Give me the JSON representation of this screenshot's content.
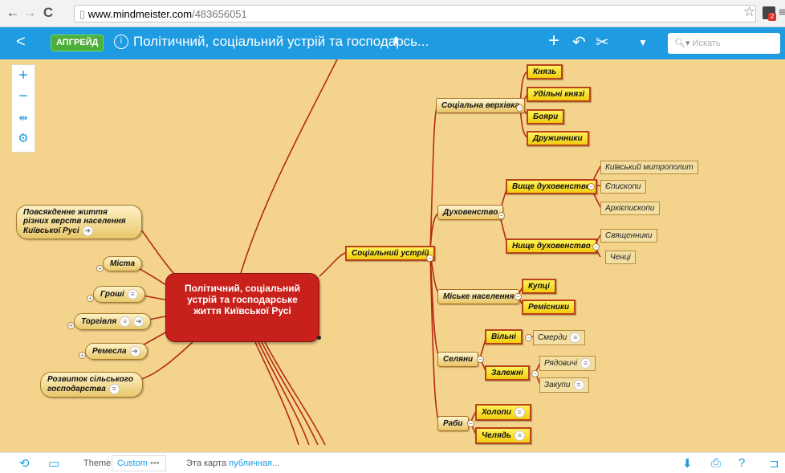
{
  "browser": {
    "url_host": "www.mindmeister.com",
    "url_path": "/483656051",
    "ext_badge": "2"
  },
  "toolbar": {
    "upgrade_label": "АПГРЕЙД",
    "title": "Політичний, соціальний устрій та господарсь...",
    "search_placeholder": "Искать",
    "accent": "#1e9be1"
  },
  "map": {
    "center": "Політичний, соціальний устрій та господарське життя Київської Русі",
    "left_nodes": {
      "daily_life": "Повсякденне життя різних верств населення Київської Русі",
      "cities": "Міста",
      "money": "Гроші",
      "trade": "Торгівля",
      "crafts": "Ремесла",
      "agriculture": "Розвиток сільського господарства"
    },
    "social": {
      "label": "Соціальний устрій",
      "elite": {
        "label": "Соціальна верхівка",
        "items": [
          "Князь",
          "Удільні князі",
          "Бояри",
          "Дружинники"
        ]
      },
      "clergy": {
        "label": "Духовенство",
        "higher": {
          "label": "Вище духовенство",
          "items": [
            "Київський митрополит",
            "Єпископи",
            "Архієпископи"
          ]
        },
        "lower": {
          "label": "Нище духовенство",
          "items": [
            "Священники",
            "Ченці"
          ]
        }
      },
      "urban": {
        "label": "Міське населення",
        "items": [
          "Купці",
          "Ремісники"
        ]
      },
      "peasants": {
        "label": "Селяни",
        "free": {
          "label": "Вільні",
          "items": [
            "Смерди"
          ]
        },
        "dependent": {
          "label": "Залежні",
          "items": [
            "Рядовичі",
            "Закупи"
          ]
        }
      },
      "slaves": {
        "label": "Раби",
        "items": [
          "Холопи",
          "Челядь"
        ]
      }
    }
  },
  "bottom": {
    "theme_label": "Theme",
    "theme_value": "Custom",
    "public_prefix": "Эта карта",
    "public_link": "публичная..."
  }
}
